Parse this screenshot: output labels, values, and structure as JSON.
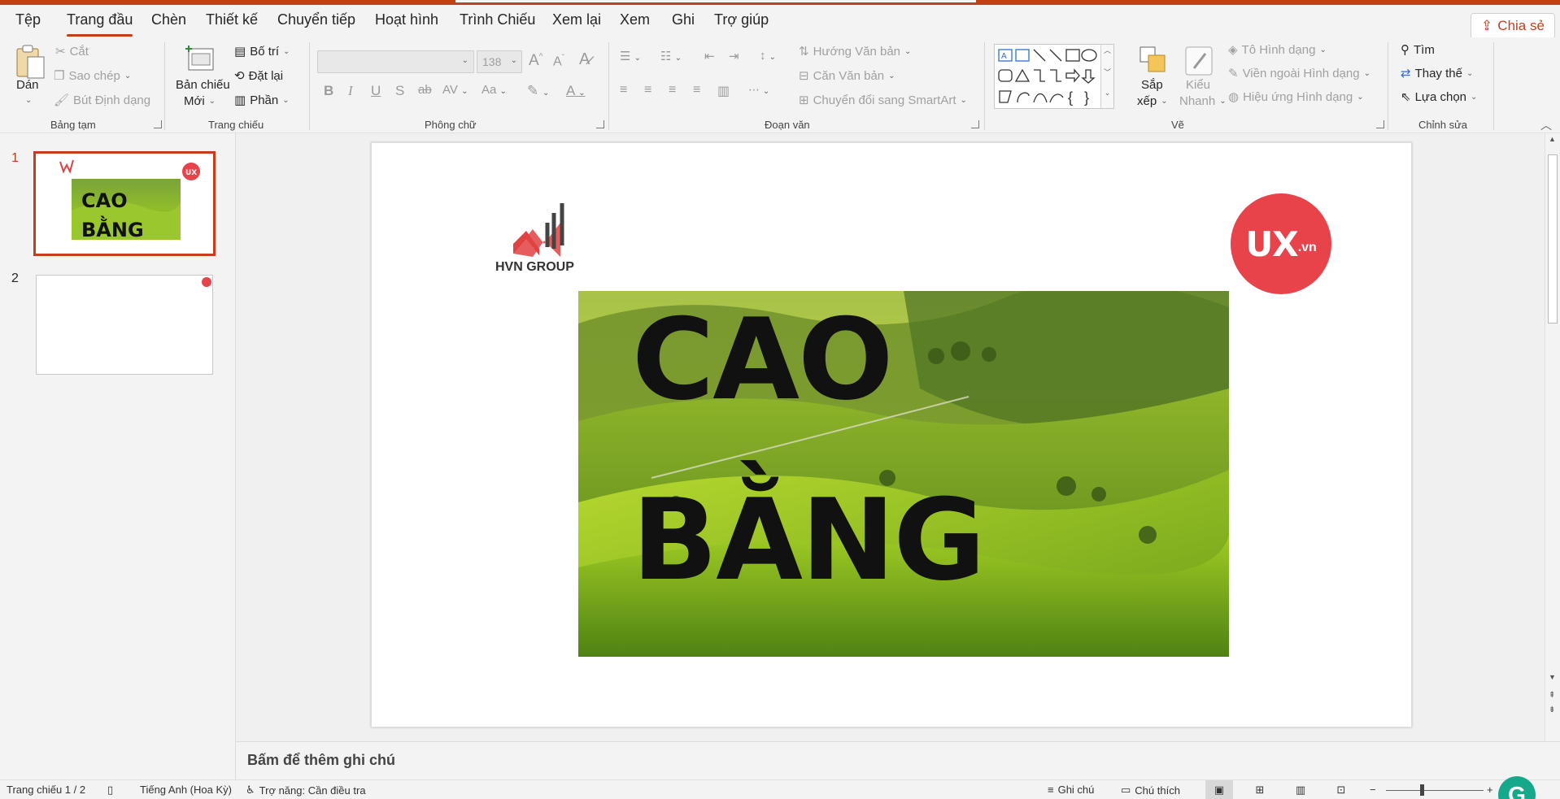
{
  "menu": {
    "tabs": [
      "Tệp",
      "Trang đầu",
      "Chèn",
      "Thiết kế",
      "Chuyển tiếp",
      "Hoạt hình",
      "Trình Chiếu",
      "Xem lại",
      "Xem",
      "Ghi",
      "Trợ giúp"
    ],
    "active_tab": "Trang đầu",
    "share_label": "Chia sẻ"
  },
  "ribbon": {
    "clipboard": {
      "paste": "Dán",
      "cut": "Cắt",
      "copy": "Sao chép",
      "format_painter": "Bút Định dạng",
      "label": "Bảng tạm"
    },
    "slides": {
      "new_slide_line1": "Bản chiếu",
      "new_slide_line2": "Mới",
      "layout": "Bố trí",
      "reset": "Đặt lại",
      "section": "Phần",
      "label": "Trang chiếu"
    },
    "font": {
      "font_name": "",
      "font_size": "138",
      "label": "Phông chữ",
      "bold": "B",
      "italic": "I",
      "underline": "U",
      "shadow": "S",
      "strike": "ab",
      "spacing": "AV",
      "case": "Aa",
      "color": "A",
      "grow": "A",
      "shrink": "A"
    },
    "paragraph": {
      "text_direction": "Hướng Văn bản",
      "align_text": "Căn Văn bản",
      "smartart": "Chuyển đổi sang SmartArt",
      "label": "Đoạn văn"
    },
    "drawing": {
      "arrange_line1": "Sắp",
      "arrange_line2": "xếp",
      "quick_styles_line1": "Kiểu",
      "quick_styles_line2": "Nhanh",
      "shape_fill": "Tô Hình dạng",
      "shape_outline": "Viền ngoài Hình dạng",
      "shape_effects": "Hiệu ứng Hình dạng",
      "label": "Vẽ"
    },
    "editing": {
      "find": "Tìm",
      "replace": "Thay thế",
      "select": "Lựa chọn",
      "label": "Chỉnh sửa"
    }
  },
  "thumbnails": [
    {
      "number": "1",
      "title": "CAO BẰNG",
      "selected": true
    },
    {
      "number": "2",
      "title": "",
      "selected": false
    }
  ],
  "slide": {
    "title_line1": "CAO",
    "title_line2": "BẰNG",
    "hvn_logo_text": "HVN GROUP",
    "ux_logo_text": "UX",
    "ux_logo_suffix": ".vn"
  },
  "notes": {
    "placeholder": "Bấm để thêm ghi chú"
  },
  "status": {
    "slide_counter": "Trang chiếu 1 / 2",
    "language": "Tiếng Anh (Hoa Kỳ)",
    "accessibility": "Trợ năng: Cần điều tra",
    "notes": "Ghi chú",
    "comments": "Chú thích"
  },
  "colors": {
    "accent": "#c43e1c",
    "ux_red": "#e8434a",
    "grammarly": "#15a88a"
  }
}
